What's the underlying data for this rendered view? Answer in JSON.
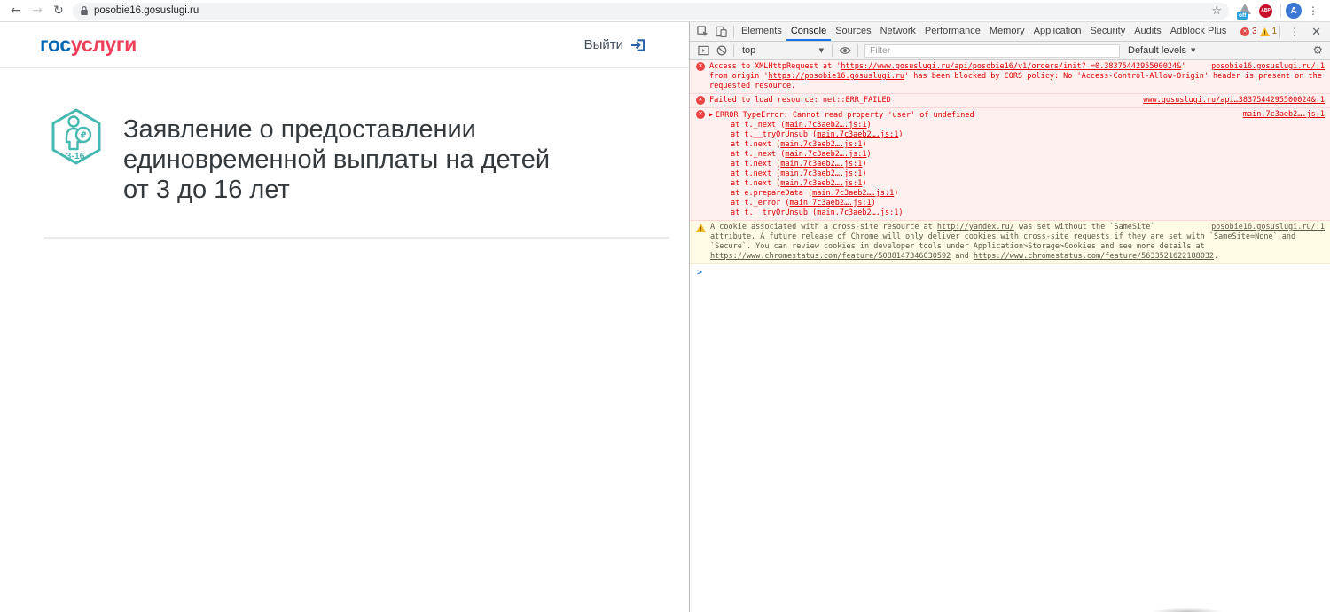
{
  "icons": {
    "back": "←",
    "forward": "→",
    "reload": "↻",
    "star": "☆",
    "kebab": "⋮",
    "close": "✕",
    "gear": "⚙",
    "caret_down": "▼",
    "expand": "▶",
    "error_x": "✕",
    "warn_excl": "!",
    "prompt": ">"
  },
  "browser": {
    "url": "posobie16.gosuslugi.ru",
    "ext_off_label": "off",
    "abp_label": "ABP",
    "avatar_letter": "A"
  },
  "page": {
    "logo_part1": "гос",
    "logo_part2": "услуги",
    "logout_label": "Выйти",
    "badge_label": "3-16",
    "title_lines": [
      "Заявление о предоставлении",
      "единовременной выплаты на детей",
      "от 3 до 16 лет"
    ]
  },
  "devtools": {
    "tabs": [
      {
        "label": "Elements",
        "active": false
      },
      {
        "label": "Console",
        "active": true
      },
      {
        "label": "Sources",
        "active": false
      },
      {
        "label": "Network",
        "active": false
      },
      {
        "label": "Performance",
        "active": false
      },
      {
        "label": "Memory",
        "active": false
      },
      {
        "label": "Application",
        "active": false
      },
      {
        "label": "Security",
        "active": false
      },
      {
        "label": "Audits",
        "active": false
      },
      {
        "label": "Adblock Plus",
        "active": false
      }
    ],
    "error_count": "3",
    "warning_count": "1",
    "context": "top",
    "filter_placeholder": "Filter",
    "levels_label": "Default levels",
    "console": {
      "cors_error": {
        "prefix": "Access to XMLHttpRequest at '",
        "url": "https://www.gosuslugi.ru/api/posobie16/v1/orders/init?_=0.3837544295500024&",
        "mid": "' from origin '",
        "origin": "https://posobie16.gosuslugi.ru",
        "suffix": "' has been blocked by CORS policy: No 'Access-Control-Allow-Origin' header is present on the requested resource.",
        "source": "posobie16.gosuslugi.ru/:1"
      },
      "net_error": {
        "text": "Failed to load resource: net::ERR_FAILED",
        "source": "www.gosuslugi.ru/api…3837544295500024&:1"
      },
      "type_error": {
        "message": "ERROR TypeError: Cannot read property 'user' of undefined",
        "source": "main.7c3aeb2….js:1",
        "at_label": "at",
        "stack": [
          {
            "fn": "t._next",
            "loc": "main.7c3aeb2….js:1"
          },
          {
            "fn": "t.__tryOrUnsub",
            "loc": "main.7c3aeb2….js:1"
          },
          {
            "fn": "t.next",
            "loc": "main.7c3aeb2….js:1"
          },
          {
            "fn": "t._next",
            "loc": "main.7c3aeb2….js:1"
          },
          {
            "fn": "t.next",
            "loc": "main.7c3aeb2….js:1"
          },
          {
            "fn": "t.next",
            "loc": "main.7c3aeb2….js:1"
          },
          {
            "fn": "t.next",
            "loc": "main.7c3aeb2….js:1"
          },
          {
            "fn": "e.prepareData",
            "loc": "main.7c3aeb2….js:1"
          },
          {
            "fn": "t._error",
            "loc": "main.7c3aeb2….js:1"
          },
          {
            "fn": "t.__tryOrUnsub",
            "loc": "main.7c3aeb2….js:1"
          }
        ]
      },
      "cookie_warning": {
        "p1": "A cookie associated with a cross-site resource at ",
        "link1": "http://yandex.ru/",
        "p2": " was set without the `SameSite` attribute. A future release of Chrome will only deliver cookies with cross-site requests if they are set with `SameSite=None` and `Secure`. You can review cookies in developer tools under Application>Storage>Cookies and see more details at ",
        "link2": "https://www.chromestatus.com/feature/5088147346030592",
        "p3": " and ",
        "link3": "https://www.chromestatus.com/feature/5633521622188032",
        "p4": ".",
        "source": "posobie16.gosuslugi.ru/:1"
      }
    }
  }
}
